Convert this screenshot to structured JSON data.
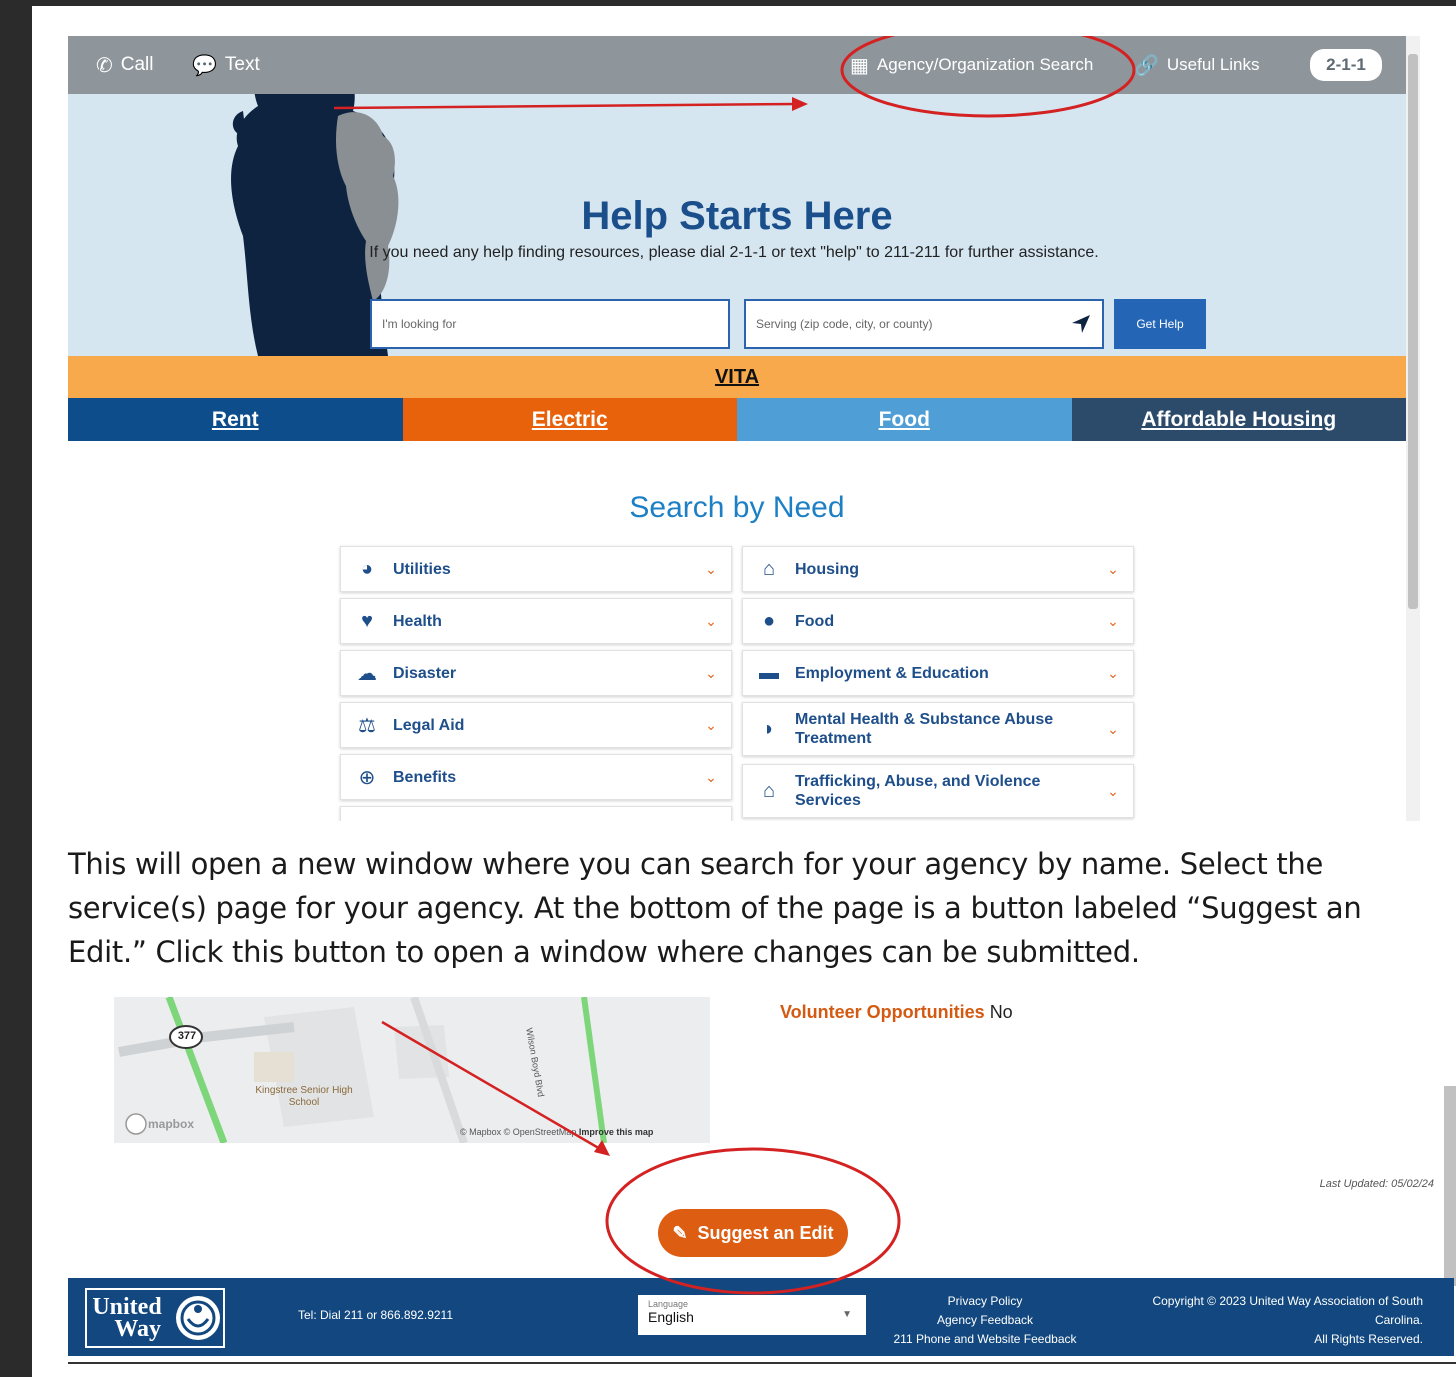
{
  "topbar": {
    "call": "Call",
    "text": "Text",
    "agency_search": "Agency/Organization Search",
    "useful_links": "Useful Links",
    "badge": "2-1-1"
  },
  "hero": {
    "title": "Help Starts Here",
    "subtitle": "If you need any help finding resources, please dial 2-1-1 or text \"help\" to 211-211 for further assistance.",
    "search_placeholder": "I'm looking for",
    "location_placeholder": "Serving (zip code, city, or county)",
    "button": "Get Help"
  },
  "banner": "VITA",
  "categories": [
    "Rent",
    "Electric",
    "Food",
    "Affordable Housing"
  ],
  "colors": {
    "rent": "#0e4d8c",
    "electric": "#e8620c",
    "food": "#4f9fd6",
    "housing": "#2c4a6a",
    "annotation": "#d42121"
  },
  "search_by_need": {
    "title": "Search by Need",
    "left": [
      {
        "label": "Utilities",
        "icon": "gauge-icon"
      },
      {
        "label": "Health",
        "icon": "heart-icon"
      },
      {
        "label": "Disaster",
        "icon": "storm-cloud-icon"
      },
      {
        "label": "Legal Aid",
        "icon": "scales-icon"
      },
      {
        "label": "Benefits",
        "icon": "plus-circle-icon"
      }
    ],
    "right": [
      {
        "label": "Housing",
        "icon": "house-icon"
      },
      {
        "label": "Food",
        "icon": "apple-icon"
      },
      {
        "label": "Employment & Education",
        "icon": "briefcase-icon"
      },
      {
        "label": "Mental Health & Substance Abuse Treatment",
        "icon": "brain-icon"
      },
      {
        "label": "Trafficking, Abuse, and Violence Services",
        "icon": "shelter-icon"
      }
    ]
  },
  "instructions": "This will open a new window where you can search for your agency by name. Select the service(s) page for your agency. At the bottom of the page is a button labeled “Suggest an Edit.” Click this button to open a window where changes can be submitted.",
  "map": {
    "route": "377",
    "school": "Kingstree Senior High School",
    "road": "Wilson Boyd Blvd",
    "brand": "mapbox",
    "attribution": "© Mapbox © OpenStreetMap",
    "improve": "Improve this map"
  },
  "detail": {
    "volunteer_label": "Volunteer Opportunities",
    "volunteer_value": "No",
    "last_updated": "Last Updated: 05/02/24",
    "suggest_button": "Suggest an Edit"
  },
  "footer": {
    "logo_line1": "United",
    "logo_line2": "Way",
    "tel": "Tel: Dial 211 or 866.892.9211",
    "language_label": "Language",
    "language_value": "English",
    "links": [
      "Privacy Policy",
      "Agency Feedback",
      "211 Phone and Website Feedback"
    ],
    "copyright_line1": "Copyright © 2023 United Way Association of South",
    "copyright_line2": "Carolina.",
    "copyright_line3": "All Rights Reserved."
  }
}
